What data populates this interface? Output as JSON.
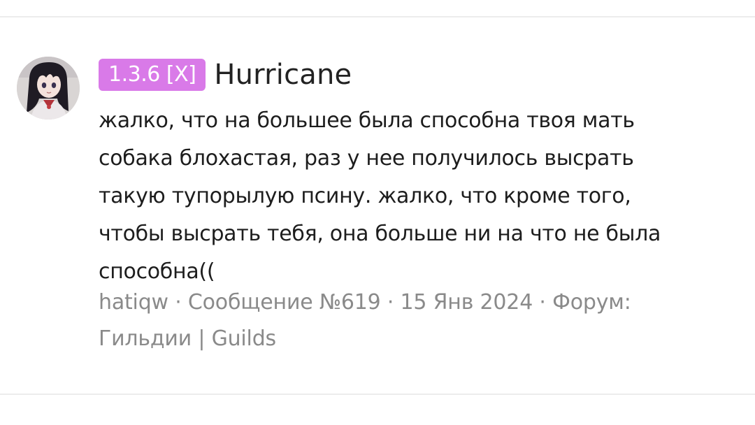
{
  "post": {
    "avatar_icon": "user-avatar-anime-girl",
    "badge": "1.3.6 [X]",
    "badge_color": "#d97ae8",
    "username": "Hurricane",
    "message": "жалко, что на большее была способна твоя мать\nсобака блохастая, раз у нее получилось высрать\nтакую тупорылую псину. жалко, что кроме того,\nчтобы высрать тебя, она больше ни на что не была\nспособна((",
    "meta": {
      "author": "hatiqw",
      "separator": " · ",
      "message_number": "Сообщение №619",
      "date": "15 Янв 2024",
      "forum_label": "Форум:",
      "forum_name": "Гильдии | Guilds"
    }
  }
}
